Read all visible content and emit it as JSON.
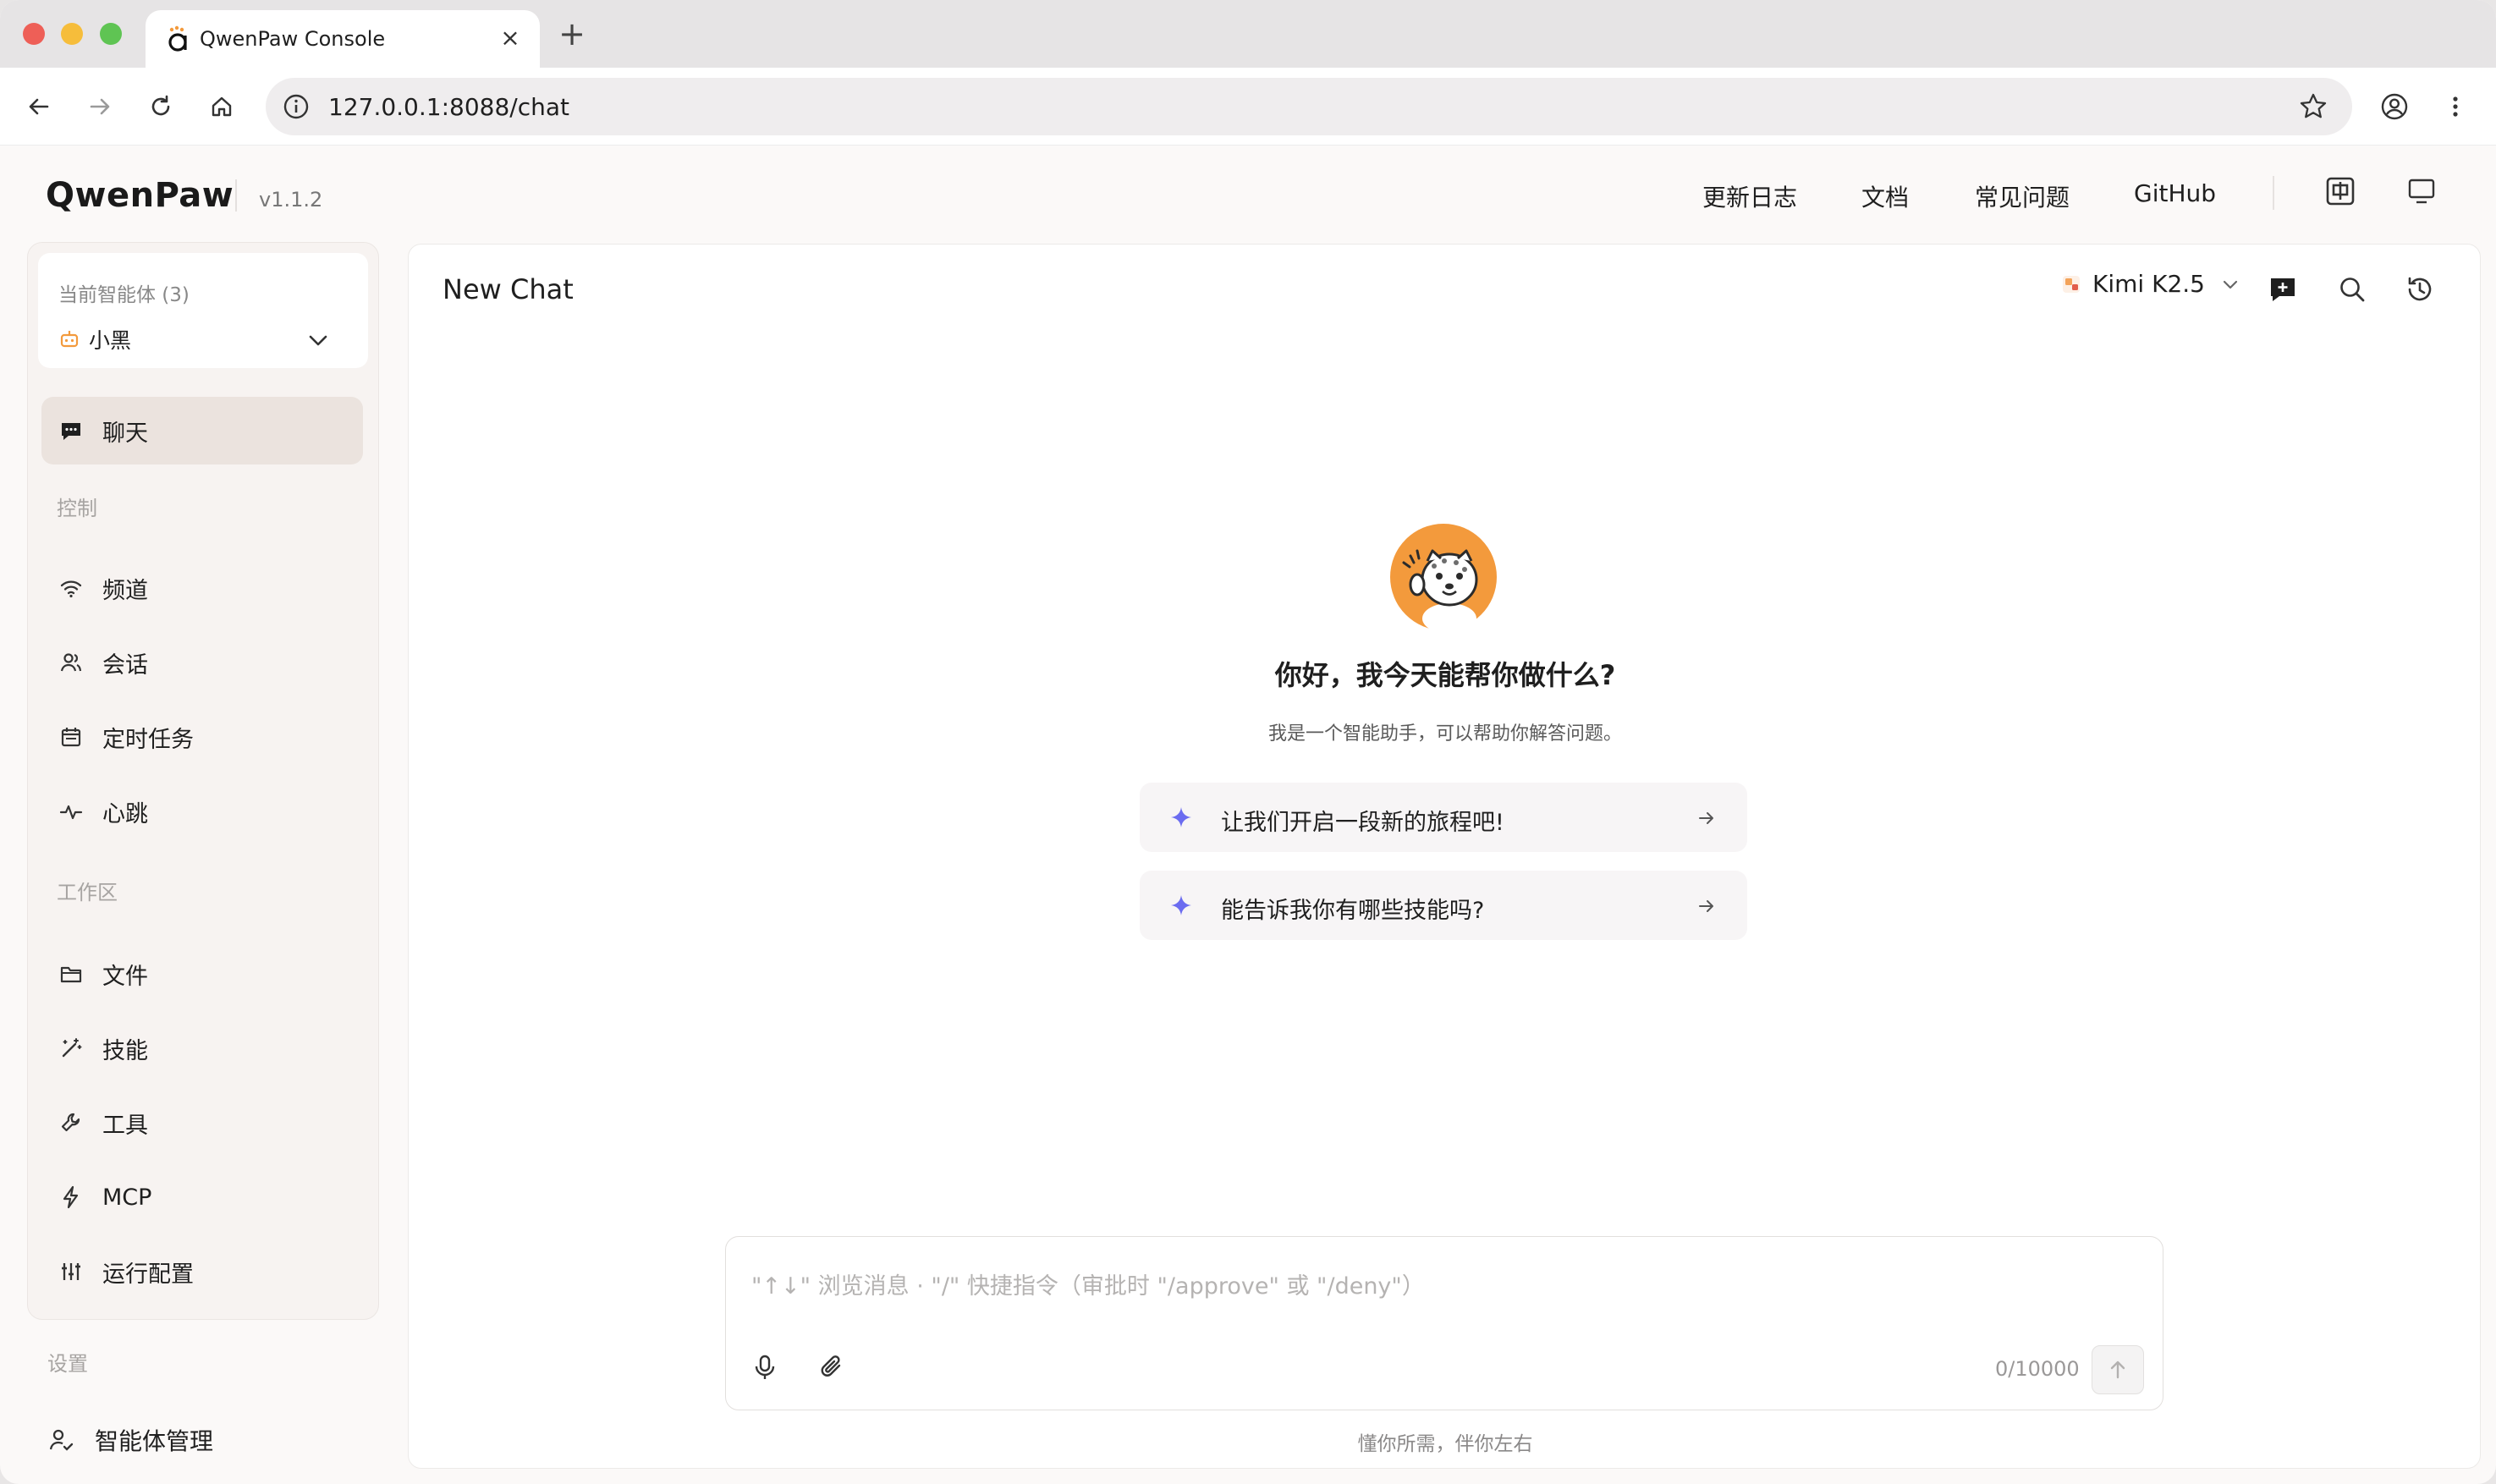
{
  "browser": {
    "tab_title": "QwenPaw Console",
    "new_tab": "+",
    "tab_close": "×",
    "url": "127.0.0.1:8088/chat"
  },
  "header": {
    "logo": "QwenPaw",
    "version": "v1.1.2",
    "nav": [
      "更新日志",
      "文档",
      "常见问题",
      "GitHub"
    ]
  },
  "sidebar": {
    "agent_label": "当前智能体 (3)",
    "agent_name": "小黑",
    "chat_label": "聊天",
    "group_control": "控制",
    "control_items": [
      "频道",
      "会话",
      "定时任务",
      "心跳"
    ],
    "group_workspace": "工作区",
    "workspace_items": [
      "文件",
      "技能",
      "工具",
      "MCP",
      "运行配置"
    ],
    "group_settings": "设置",
    "settings_item": "智能体管理"
  },
  "main": {
    "title": "New Chat",
    "model_name": "Kimi K2.5",
    "greeting_title": "你好，我今天能帮你做什么?",
    "greeting_sub": "我是一个智能助手，可以帮助你解答问题。",
    "suggestions": [
      "让我们开启一段新的旅程吧!",
      "能告诉我你有哪些技能吗?"
    ],
    "composer_placeholder": "\"↑↓\" 浏览消息 · \"/\" 快捷指令（审批时 \"/approve\" 或 \"/deny\"）",
    "composer_value": "",
    "char_count": "0/10000",
    "footer": "懂你所需，伴你左右"
  },
  "colors": {
    "accent_orange": "#f39a3c",
    "sparkle_purple": "#6b6cf0",
    "active_bg": "#ebe3de"
  }
}
